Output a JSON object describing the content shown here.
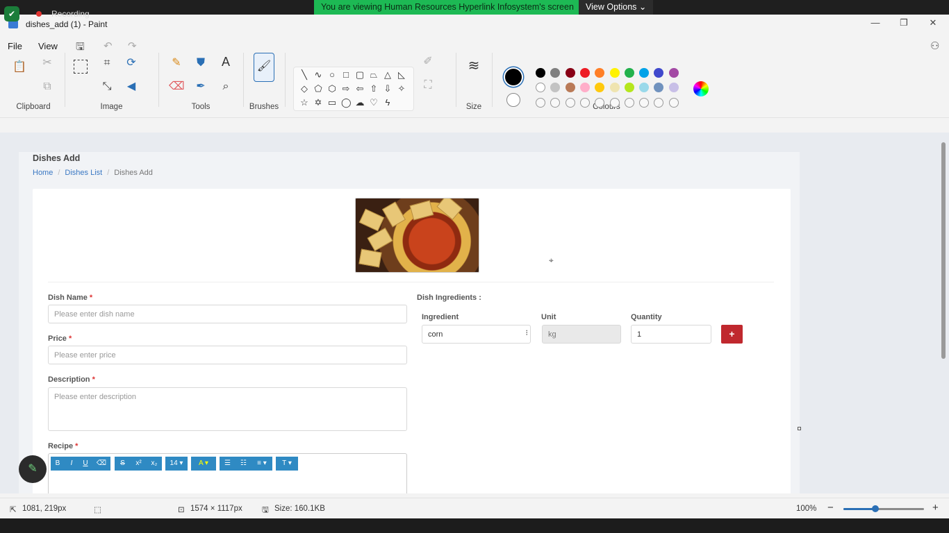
{
  "share": {
    "recording": "Recording",
    "banner": "You are viewing Human Resources Hyperlink Infosystem's screen",
    "view_options": "View Options"
  },
  "window": {
    "title": "dishes_add (1) - Paint",
    "menu": [
      "File",
      "View"
    ]
  },
  "ribbon": {
    "groups": [
      "Clipboard",
      "Image",
      "Tools",
      "Brushes",
      "Shapes",
      "Size",
      "Colours"
    ],
    "colours_row1": [
      "#000000",
      "#7f7f7f",
      "#880015",
      "#ed1c24",
      "#ff7f27",
      "#fff200",
      "#22b14c",
      "#00a2e8",
      "#3f48cc",
      "#a349a4"
    ],
    "colours_row2": [
      "#ffffff",
      "#c3c3c3",
      "#b97a57",
      "#ffaec9",
      "#ffc90e",
      "#efe4b0",
      "#b5e61d",
      "#99d9ea",
      "#7092be",
      "#c8bfe7"
    ],
    "primary_colour": "#000000",
    "secondary_colour": "#ffffff"
  },
  "page": {
    "title": "Dishes Add",
    "breadcrumb": [
      "Home",
      "Dishes List",
      "Dishes Add"
    ],
    "form": {
      "dish_name_label": "Dish Name",
      "dish_name_placeholder": "Please enter dish name",
      "price_label": "Price",
      "price_placeholder": "Please enter price",
      "description_label": "Description",
      "description_placeholder": "Please enter description",
      "recipe_label": "Recipe",
      "required_mark": "*"
    },
    "ingredients": {
      "heading": "Dish Ingredients :",
      "col_ingredient": "Ingredient",
      "col_unit": "Unit",
      "col_quantity": "Quantity",
      "ingredient_value": "corn",
      "unit_value": "kg",
      "quantity_value": "1",
      "add_label": "+"
    },
    "editor_toolbar": [
      "B",
      "I",
      "U",
      "⌫",
      "S",
      "x²",
      "x₂",
      "14 ▾",
      "A ▾",
      "☰",
      "☷",
      "≡ ▾",
      "T ▾"
    ]
  },
  "status": {
    "cursor_pos": "1081, 219px",
    "canvas_size": "1574 × 1117px",
    "file_size": "Size: 160.1KB",
    "zoom": "100%",
    "zoom_level": 0.4
  }
}
